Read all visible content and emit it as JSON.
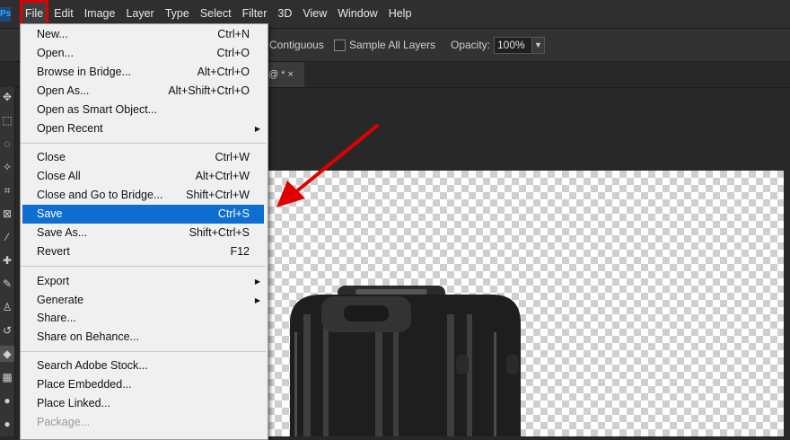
{
  "menubar": {
    "items": [
      "File",
      "Edit",
      "Image",
      "Layer",
      "Type",
      "Select",
      "Filter",
      "3D",
      "View",
      "Window",
      "Help"
    ]
  },
  "options": {
    "contiguous": "Contiguous",
    "sample_all_layers": "Sample All Layers",
    "opacity_label": "Opacity:",
    "opacity_value": "100%"
  },
  "tab": {
    "label": "@ * ×"
  },
  "file_menu": {
    "items": [
      {
        "label": "New...",
        "shortcut": "Ctrl+N"
      },
      {
        "label": "Open...",
        "shortcut": "Ctrl+O"
      },
      {
        "label": "Browse in Bridge...",
        "shortcut": "Alt+Ctrl+O"
      },
      {
        "label": "Open As...",
        "shortcut": "Alt+Shift+Ctrl+O"
      },
      {
        "label": "Open as Smart Object...",
        "shortcut": ""
      },
      {
        "label": "Open Recent",
        "shortcut": ""
      },
      {
        "label": "Close",
        "shortcut": "Ctrl+W"
      },
      {
        "label": "Close All",
        "shortcut": "Alt+Ctrl+W"
      },
      {
        "label": "Close and Go to Bridge...",
        "shortcut": "Shift+Ctrl+W"
      },
      {
        "label": "Save",
        "shortcut": "Ctrl+S"
      },
      {
        "label": "Save As...",
        "shortcut": "Shift+Ctrl+S"
      },
      {
        "label": "Revert",
        "shortcut": "F12"
      },
      {
        "label": "Export",
        "shortcut": ""
      },
      {
        "label": "Generate",
        "shortcut": ""
      },
      {
        "label": "Share...",
        "shortcut": ""
      },
      {
        "label": "Share on Behance...",
        "shortcut": ""
      },
      {
        "label": "Search Adobe Stock...",
        "shortcut": ""
      },
      {
        "label": "Place Embedded...",
        "shortcut": ""
      },
      {
        "label": "Place Linked...",
        "shortcut": ""
      },
      {
        "label": "Package...",
        "shortcut": ""
      }
    ]
  },
  "colors": {
    "highlight": "#0f6fd0",
    "annotation_red": "#e00000"
  }
}
